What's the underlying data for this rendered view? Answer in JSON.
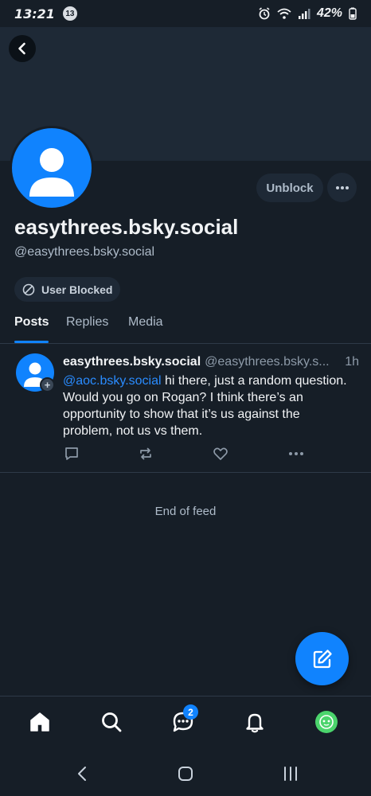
{
  "status_bar": {
    "time": "13:21",
    "notification_badge": "13",
    "battery": "42%"
  },
  "header": {
    "back_icon": "chevron-left-icon"
  },
  "profile": {
    "display_name": "easythrees.bsky.social",
    "handle": "@easythrees.bsky.social",
    "unblock_label": "Unblock",
    "blocked_label": "User Blocked",
    "avatar_color": "#1083fe"
  },
  "tabs": [
    {
      "label": "Posts",
      "active": true
    },
    {
      "label": "Replies",
      "active": false
    },
    {
      "label": "Media",
      "active": false
    }
  ],
  "post": {
    "author_name": "easythrees.bsky.social",
    "author_handle": "@easythrees.bsky.s...",
    "time": "1h",
    "mention": "@aoc.bsky.social",
    "text": " hi there, just a random question. Would you go on Rogan? I think there’s an opportunity to show that it’s us against the problem, not us vs them."
  },
  "feed": {
    "end_label": "End of feed"
  },
  "bottom_nav": {
    "chat_badge": "2",
    "items": [
      "home-icon",
      "search-icon",
      "chat-icon",
      "bell-icon",
      "profile-avatar"
    ]
  },
  "colors": {
    "background": "#161e27",
    "accent": "#1083fe",
    "banner": "#1e2936"
  }
}
